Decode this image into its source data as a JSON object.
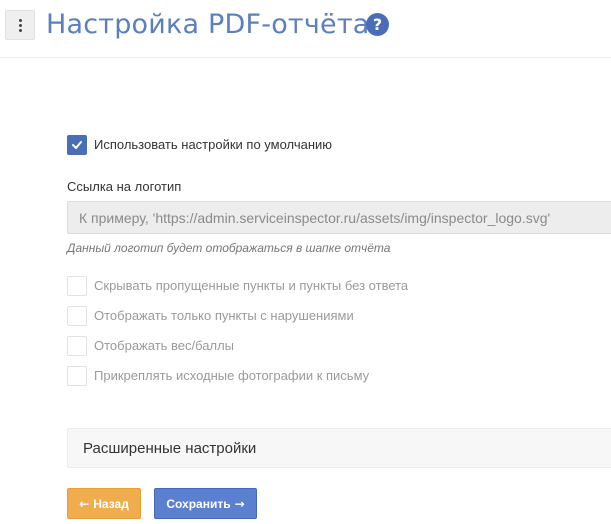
{
  "header": {
    "title": "Настройка PDF-отчёта",
    "menu_icon": "vertical-dots-icon",
    "help_icon": "question-circle-icon",
    "help_glyph": "?"
  },
  "settings": {
    "use_defaults": {
      "label": "Использовать настройки по умолчанию",
      "checked": true
    },
    "logo_link": {
      "label": "Ссылка на логотип",
      "value": "",
      "placeholder": "К примеру, 'https://admin.serviceinspector.ru/assets/img/inspector_logo.svg'",
      "hint": "Данный логотип будет отображаться в шапке отчёта"
    },
    "options": [
      {
        "label": "Скрывать пропущенные пункты и пункты без ответа",
        "checked": false
      },
      {
        "label": "Отображать только пункты с нарушениями",
        "checked": false
      },
      {
        "label": "Отображать вес/баллы",
        "checked": false
      },
      {
        "label": "Прикреплять исходные фотографии к письму",
        "checked": false
      }
    ]
  },
  "advanced": {
    "label": "Расширенные настройки"
  },
  "buttons": {
    "back": {
      "label": "Назад",
      "icon": "arrow-left-icon",
      "color": "#f0ad4e"
    },
    "save": {
      "label": "Сохранить",
      "icon": "arrow-right-icon",
      "color": "#5b80cf"
    }
  },
  "colors": {
    "accent": "#4a6eb5",
    "title": "#5b7fbf"
  }
}
